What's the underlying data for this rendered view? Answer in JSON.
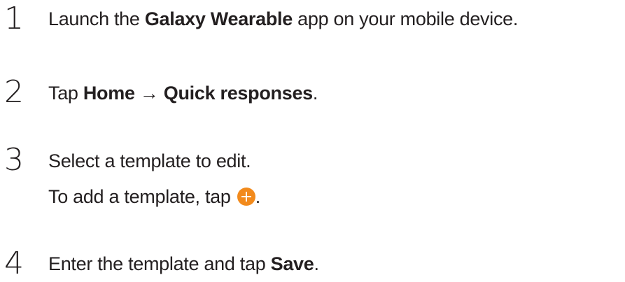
{
  "steps": [
    {
      "number": "1",
      "line1": {
        "before": "Launch the ",
        "bold1": "Galaxy Wearable",
        "after": " app on your mobile device."
      }
    },
    {
      "number": "2",
      "line1": {
        "before": "Tap ",
        "bold1": "Home",
        "arrow": " → ",
        "bold2": "Quick responses",
        "after": "."
      }
    },
    {
      "number": "3",
      "line1": {
        "text": "Select a template to edit."
      },
      "line2": {
        "before": "To add a template, tap ",
        "icon": "add-circle-icon",
        "after": "."
      }
    },
    {
      "number": "4",
      "line1": {
        "before": "Enter the template and tap ",
        "bold1": "Save",
        "after": "."
      }
    }
  ],
  "colors": {
    "text": "#231f20",
    "accent": "#f28a1c"
  }
}
